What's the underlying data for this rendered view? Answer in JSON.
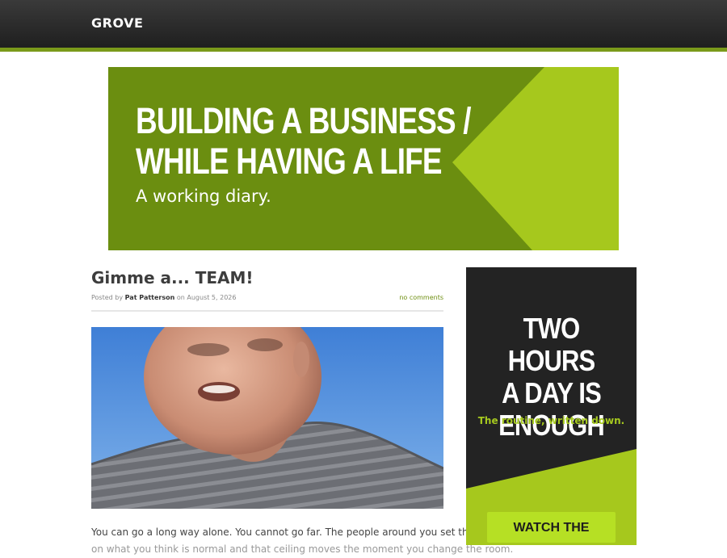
{
  "header": {
    "site_name": "GROVE"
  },
  "banner": {
    "headline_line1": "BUILDING A BUSINESS /",
    "headline_line2": "WHILE HAVING A LIFE",
    "tagline": "A working diary."
  },
  "post": {
    "title": "Gimme a... TEAM!",
    "meta_prefix": "Posted by",
    "author": "Pat Patterson",
    "meta_on": "on",
    "date": "August 5, 2026",
    "comments_link": "no comments",
    "excerpt_line1": "You can go a long way alone. You cannot go far. The people around you set the ceiling",
    "excerpt_line2": "on what you think is normal and that ceiling moves the moment you change the room."
  },
  "sidebar_ad": {
    "headline_line1": "TWO HOURS",
    "headline_line2": "A DAY IS",
    "headline_line3": "ENOUGH",
    "subline": "The routine, written down.",
    "button_label": "WATCH THE VIDEO"
  },
  "colors": {
    "accent_green": "#7a9a1a",
    "banner_green": "#6b8e10",
    "lime": "#b6e024",
    "dark": "#232323"
  }
}
